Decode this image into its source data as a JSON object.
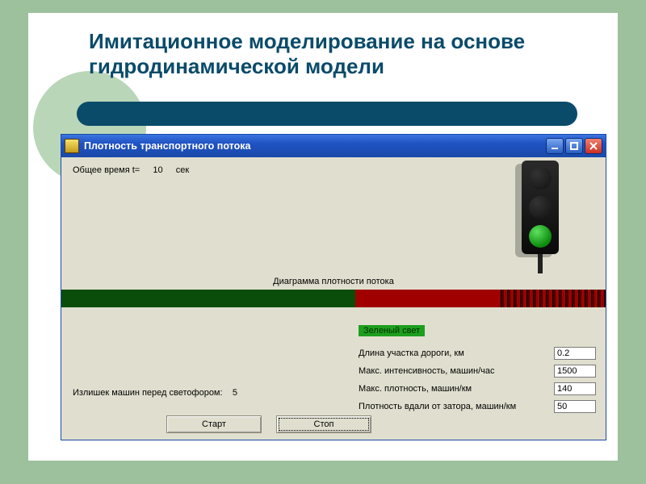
{
  "slide": {
    "title": "Имитационное моделирование на основе гидродинамической модели"
  },
  "window": {
    "title": "Плотность транспортного потока"
  },
  "sim": {
    "time_label": "Общее время t=",
    "time_value": "10",
    "time_unit": "сек",
    "diagram_label": "Диаграмма плотности потока",
    "green_label": "Зеленый свет",
    "surplus_label": "Излишек машин перед светофором:",
    "surplus_value": "5"
  },
  "params": {
    "length_label": "Длина участка дороги, км",
    "length_value": "0.2",
    "max_intensity_label": "Макс. интенсивность, машин/час",
    "max_intensity_value": "1500",
    "max_density_label": "Макс. плотность, машин/км",
    "max_density_value": "140",
    "far_density_label": "Плотность вдали от затора, машин/км",
    "far_density_value": "50"
  },
  "buttons": {
    "start": "Старт",
    "stop": "Стоп"
  }
}
